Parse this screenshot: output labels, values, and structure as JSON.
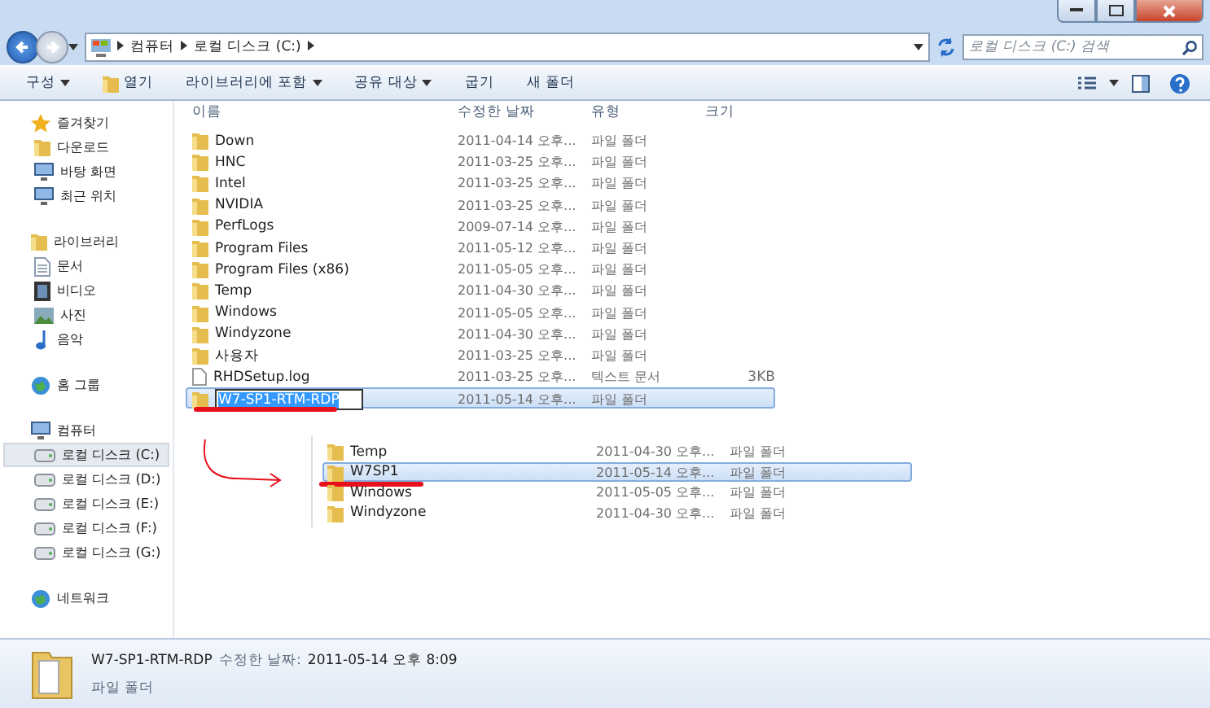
{
  "address_bar": {
    "crumbs": [
      "컴퓨터",
      "로컬 디스크 (C:)"
    ],
    "search": {
      "placeholder": "로컬 디스크 (C:) 검색"
    }
  },
  "toolbar": {
    "buttons": [
      {
        "label": "구성",
        "kind": "menu"
      },
      {
        "label": "열기",
        "kind": "icon"
      },
      {
        "label": "라이브러리에 포함",
        "kind": "menu"
      },
      {
        "label": "공유 대상",
        "kind": "menu"
      },
      {
        "label": "굽기",
        "kind": "plain"
      },
      {
        "label": "새 폴더",
        "kind": "plain"
      }
    ]
  },
  "sidebar": {
    "groups": [
      {
        "label": "즐겨찾기",
        "kind": "star",
        "items": [
          {
            "label": "다운로드",
            "kind": "folder",
            "selected": false
          },
          {
            "label": "바탕 화면",
            "kind": "monitor",
            "selected": false
          },
          {
            "label": "최근 위치",
            "kind": "monitor",
            "selected": false
          }
        ]
      },
      {
        "label": "라이브러리",
        "kind": "folder",
        "items": [
          {
            "label": "문서",
            "kind": "document",
            "selected": false
          },
          {
            "label": "비디오",
            "kind": "film",
            "selected": false
          },
          {
            "label": "사진",
            "kind": "picture",
            "selected": false
          },
          {
            "label": "음악",
            "kind": "note",
            "selected": false
          }
        ]
      },
      {
        "label": "홈 그룹",
        "kind": "globe"
      },
      {
        "label": "컴퓨터",
        "kind": "monitor",
        "items": [
          {
            "label": "로컬 디스크 (C:)",
            "kind": "drive",
            "selected": true
          },
          {
            "label": "로컬 디스크 (D:)",
            "kind": "drive",
            "selected": false
          },
          {
            "label": "로컬 디스크 (E:)",
            "kind": "drive",
            "selected": false
          },
          {
            "label": "로컬 디스크 (F:)",
            "kind": "drive",
            "selected": false
          },
          {
            "label": "로컬 디스크 (G:)",
            "kind": "drive",
            "selected": false
          }
        ]
      },
      {
        "label": "네트워크",
        "kind": "globe"
      }
    ]
  },
  "file_list": {
    "columns": [
      "이름",
      "수정한 날짜",
      "유형",
      "크기"
    ],
    "rows": [
      {
        "name": "Down",
        "date": "2011-04-14 오후...",
        "type": "파일 폴더",
        "kind": "folder",
        "selected": false,
        "editing": false,
        "underlined": false
      },
      {
        "name": "HNC",
        "date": "2011-03-25 오후...",
        "type": "파일 폴더",
        "kind": "folder",
        "selected": false,
        "editing": false,
        "underlined": false
      },
      {
        "name": "Intel",
        "date": "2011-03-25 오후...",
        "type": "파일 폴더",
        "kind": "folder",
        "selected": false,
        "editing": false,
        "underlined": false
      },
      {
        "name": "NVIDIA",
        "date": "2011-03-25 오후...",
        "type": "파일 폴더",
        "kind": "folder",
        "selected": false,
        "editing": false,
        "underlined": false
      },
      {
        "name": "PerfLogs",
        "date": "2009-07-14 오후...",
        "type": "파일 폴더",
        "kind": "folder",
        "selected": false,
        "editing": false,
        "underlined": false
      },
      {
        "name": "Program Files",
        "date": "2011-05-12 오후...",
        "type": "파일 폴더",
        "kind": "folder",
        "selected": false,
        "editing": false,
        "underlined": false
      },
      {
        "name": "Program Files (x86)",
        "date": "2011-05-05 오후...",
        "type": "파일 폴더",
        "kind": "folder",
        "selected": false,
        "editing": false,
        "underlined": false
      },
      {
        "name": "Temp",
        "date": "2011-04-30 오후...",
        "type": "파일 폴더",
        "kind": "folder",
        "selected": false,
        "editing": false,
        "underlined": false
      },
      {
        "name": "Windows",
        "date": "2011-05-05 오후...",
        "type": "파일 폴더",
        "kind": "folder",
        "selected": false,
        "editing": false,
        "underlined": false
      },
      {
        "name": "Windyzone",
        "date": "2011-04-30 오후...",
        "type": "파일 폴더",
        "kind": "folder",
        "selected": false,
        "editing": false,
        "underlined": false
      },
      {
        "name": "사용자",
        "date": "2011-03-25 오후...",
        "type": "파일 폴더",
        "kind": "folder",
        "selected": false,
        "editing": false,
        "underlined": false
      },
      {
        "name": "RHDSetup.log",
        "date": "2011-03-25 오후...",
        "type": "텍스트 문서",
        "size": "3KB",
        "kind": "file",
        "selected": false,
        "editing": false,
        "underlined": false
      },
      {
        "name": "W7-SP1-RTM-RDP",
        "date": "2011-05-14 오후...",
        "type": "파일 폴더",
        "kind": "folder",
        "selected": true,
        "editing": true,
        "underlined": true
      }
    ]
  },
  "inset_list": {
    "rows": [
      {
        "name": "Temp",
        "date": "2011-04-30 오후...",
        "type": "파일 폴더",
        "selected": false,
        "underlined": false
      },
      {
        "name": "W7SP1",
        "date": "2011-05-14 오후...",
        "type": "파일 폴더",
        "selected": true,
        "underlined": true
      },
      {
        "name": "Windows",
        "date": "2011-05-05 오후...",
        "type": "파일 폴더",
        "selected": false,
        "underlined": false
      },
      {
        "name": "Windyzone",
        "date": "2011-04-30 오후...",
        "type": "파일 폴더",
        "selected": false,
        "underlined": false
      }
    ]
  },
  "details": {
    "name": "W7-SP1-RTM-RDP",
    "date_label": "수정한 날짜:",
    "date": "2011-05-14 오후 8:09",
    "type": "파일 폴더"
  }
}
